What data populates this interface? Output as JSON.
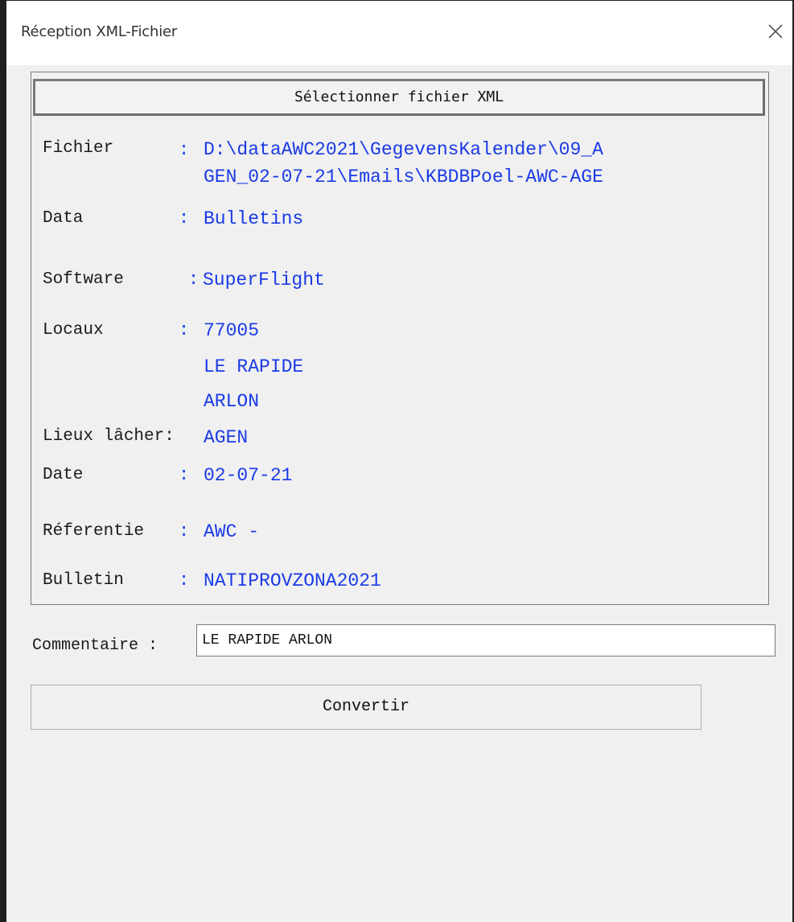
{
  "window": {
    "title": "Réception XML-Fichier"
  },
  "groupbox": {
    "select_button_label": "Sélectionner fichier XML",
    "rows": {
      "fichier": {
        "label": "Fichier",
        "value_line1": "D:\\dataAWC2021\\GegevensKalender\\09_A",
        "value_line2": "GEN_02-07-21\\Emails\\KBDBPoel-AWC-AGE"
      },
      "data": {
        "label": "Data",
        "value": "Bulletins"
      },
      "software": {
        "label": "Software",
        "value": "SuperFlight"
      },
      "locaux": {
        "label": "Locaux",
        "value_line1": "77005",
        "value_line2": "LE RAPIDE",
        "value_line3": "ARLON"
      },
      "lieux": {
        "label": "Lieux lâcher:",
        "value": "AGEN"
      },
      "date": {
        "label": "Date",
        "value": "02-07-21"
      },
      "referentie": {
        "label": "Réferentie",
        "value": "AWC -"
      },
      "bulletin": {
        "label": "Bulletin",
        "value": "NATIPROVZONA2021"
      }
    },
    "colon": ":"
  },
  "comment": {
    "label": "Commentaire :",
    "value": "LE RAPIDE ARLON"
  },
  "convert_button": {
    "label": "Convertir"
  },
  "colors": {
    "value_blue": "#1a3ae6",
    "window_bg": "#f0f0f0",
    "titlebar_bg": "#ffffff"
  },
  "icons": {
    "close": "close-icon"
  }
}
